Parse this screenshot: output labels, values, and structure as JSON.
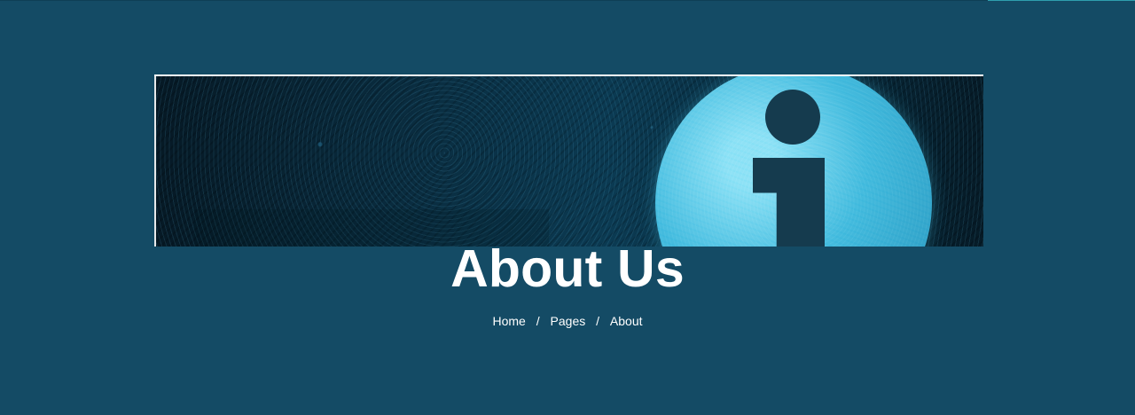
{
  "header": {
    "title": "About Us",
    "breadcrumb": {
      "items": [
        {
          "label": "Home"
        },
        {
          "label": "Pages"
        },
        {
          "label": "About"
        }
      ],
      "separator": "/"
    }
  },
  "banner": {
    "icon": "info-icon"
  },
  "colors": {
    "background": "#144b65",
    "text": "#ffffff",
    "banner_border": "#ffffff",
    "accent": "#2f9fae"
  }
}
